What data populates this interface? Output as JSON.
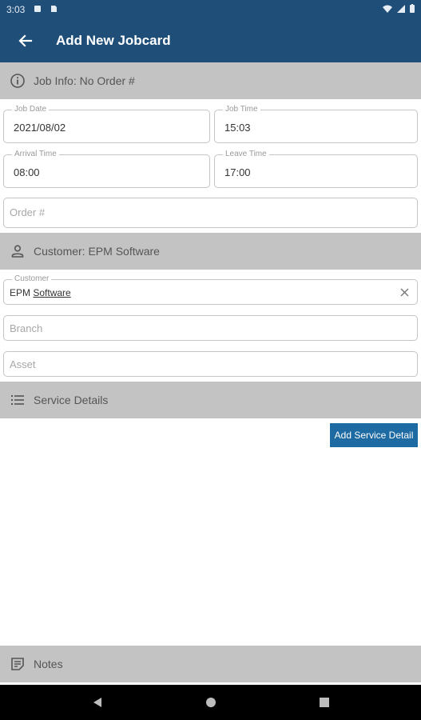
{
  "status_bar": {
    "time": "3:03"
  },
  "app_bar": {
    "title": "Add New Jobcard",
    "back_icon": "arrow-left"
  },
  "sections": {
    "job_info": {
      "label": "Job Info: No Order #",
      "icon": "info-circle"
    },
    "customer": {
      "label": "Customer: EPM Software",
      "icon": "person"
    },
    "service_details": {
      "label": "Service Details",
      "icon": "list"
    },
    "notes": {
      "label": "Notes",
      "icon": "note"
    }
  },
  "fields": {
    "job_date": {
      "label": "Job Date",
      "value": "2021/08/02"
    },
    "job_time": {
      "label": "Job Time",
      "value": "15:03"
    },
    "arrival_time": {
      "label": "Arrival Time",
      "value": "08:00"
    },
    "leave_time": {
      "label": "Leave Time",
      "value": "17:00"
    },
    "order_number": {
      "placeholder": "Order #"
    },
    "customer": {
      "label": "Customer",
      "value_prefix": "EPM ",
      "value_underlined": "Software"
    },
    "branch": {
      "placeholder": "Branch"
    },
    "asset": {
      "placeholder": "Asset"
    }
  },
  "buttons": {
    "add_service_detail": "Add Service Detail"
  },
  "colors": {
    "primary": "#1f4e79",
    "button": "#1e6aa2",
    "section_bg": "#c3c3c3"
  }
}
